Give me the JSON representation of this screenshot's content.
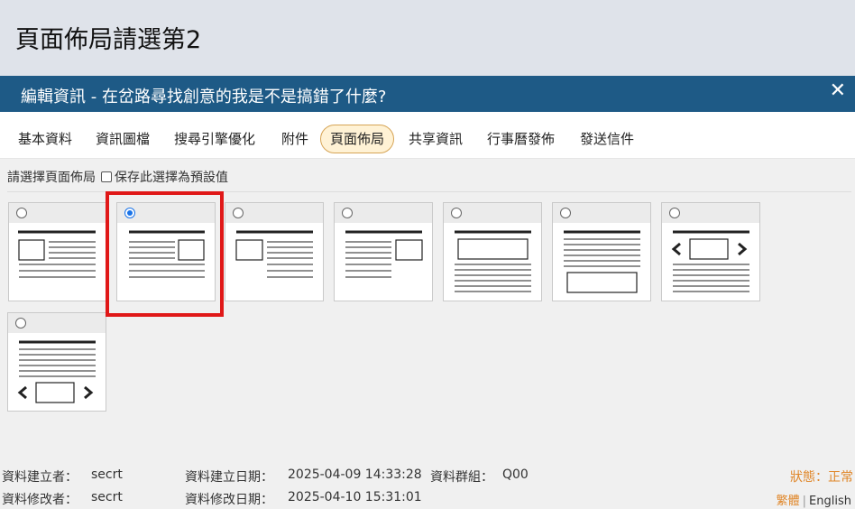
{
  "page": {
    "title": "頁面佈局請選第2"
  },
  "dialog": {
    "title": "編輯資訊 - 在岔路尋找創意的我是不是搞錯了什麼?",
    "close": "✕"
  },
  "tabs": [
    {
      "label": "基本資料",
      "active": false
    },
    {
      "label": "資訊圖檔",
      "active": false
    },
    {
      "label": "搜尋引擎優化",
      "active": false
    },
    {
      "label": "附件",
      "active": false
    },
    {
      "label": "頁面佈局",
      "active": true
    },
    {
      "label": "共享資訊",
      "active": false
    },
    {
      "label": "行事曆發佈",
      "active": false
    },
    {
      "label": "發送信件",
      "active": false
    }
  ],
  "layout": {
    "prompt": "請選擇頁面佈局",
    "default_checkbox_label": "保存此選擇為預設值",
    "selected_index": 1,
    "options": [
      {
        "name": "image-left-text"
      },
      {
        "name": "image-right-text"
      },
      {
        "name": "image-left-no-title"
      },
      {
        "name": "text-image-right-mid"
      },
      {
        "name": "image-top-wide"
      },
      {
        "name": "image-bottom-wide"
      },
      {
        "name": "carousel-top"
      },
      {
        "name": "carousel-bottom"
      }
    ]
  },
  "footer": {
    "creator_label": "資料建立者：",
    "creator_value": "secrt",
    "modifier_label": "資料修改者：",
    "modifier_value": "secrt",
    "created_label": "資料建立日期：",
    "created_value": "2025-04-09 14:33:28",
    "group_label": "資料群組：",
    "group_value": "Q00",
    "modified_label": "資料修改日期：",
    "modified_value": "2025-04-10 15:31:01",
    "status_label": "狀態：",
    "status_value": "正常",
    "lang_tw": "繁體",
    "lang_en": "English"
  },
  "colors": {
    "header": "#1e5a86",
    "accent": "#e0872a",
    "highlight": "#e01818",
    "radio": "#1a73e8"
  }
}
